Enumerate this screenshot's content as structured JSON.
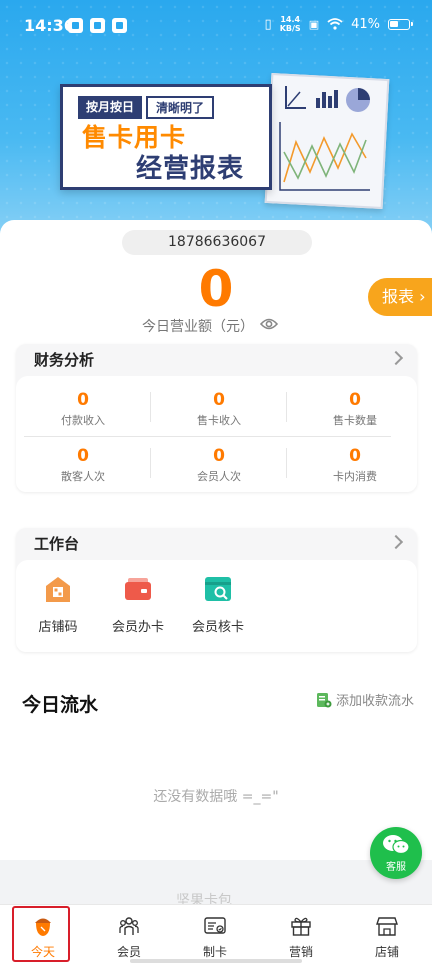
{
  "status_bar": {
    "time": "14:36",
    "speed_value": "14.4",
    "speed_unit": "KB/S",
    "battery": "41%"
  },
  "banner": {
    "tag1": "按月按日",
    "tag2": "清晰明了",
    "line1": "售卡用卡",
    "line2": "经营报表"
  },
  "summary": {
    "phone": "18786636067",
    "amount": "0",
    "amount_label": "今日营业额（元）",
    "report_button": "报表"
  },
  "finance": {
    "title": "财务分析",
    "stats": [
      {
        "value": "0",
        "label": "付款收入"
      },
      {
        "value": "0",
        "label": "售卡收入"
      },
      {
        "value": "0",
        "label": "售卡数量"
      },
      {
        "value": "0",
        "label": "散客人次"
      },
      {
        "value": "0",
        "label": "会员人次"
      },
      {
        "value": "0",
        "label": "卡内消费"
      }
    ]
  },
  "workbench": {
    "title": "工作台",
    "tools": [
      {
        "label": "店铺码",
        "icon": "store-icon"
      },
      {
        "label": "会员办卡",
        "icon": "card-icon"
      },
      {
        "label": "会员核卡",
        "icon": "verify-card-icon"
      }
    ]
  },
  "flow": {
    "title": "今日流水",
    "add_label": "添加收款流水",
    "empty_text": "还没有数据哦 =_=\"",
    "footer_text": "坚果卡包"
  },
  "service": {
    "label": "客服"
  },
  "tabs": [
    {
      "label": "今天",
      "icon": "acorn-icon"
    },
    {
      "label": "会员",
      "icon": "members-icon"
    },
    {
      "label": "制卡",
      "icon": "make-card-icon"
    },
    {
      "label": "营销",
      "icon": "gift-icon"
    },
    {
      "label": "店铺",
      "icon": "shop-icon"
    }
  ],
  "colors": {
    "accent": "#ff7a00",
    "report": "#f8a51c",
    "header": "#2aa8ee",
    "service": "#1fbf4c",
    "highlight": "#d81e2a"
  }
}
